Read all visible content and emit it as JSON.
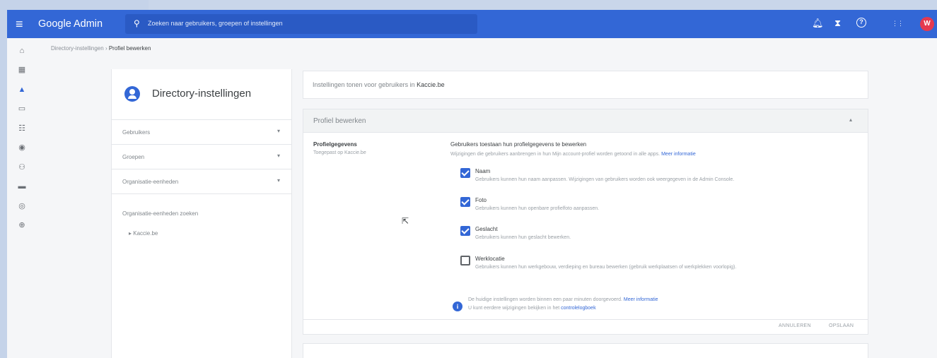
{
  "topbar": {
    "menu_icon": "≡",
    "brand": "Google Admin",
    "search_icon": "⚲",
    "search_placeholder": "Zoeken naar gebruikers, groepen of instellingen",
    "icons": [
      {
        "name": "notifications-icon",
        "glyph": "🔔︎"
      },
      {
        "name": "hourglass-icon",
        "glyph": "⧗"
      },
      {
        "name": "help-icon",
        "glyph": "?"
      },
      {
        "name": "apps-icon",
        "glyph": "⋮⋮"
      }
    ],
    "avatar_letter": "W",
    "colors": {
      "bar": "#3367d6",
      "avatar": "#e53950"
    }
  },
  "rail": {
    "icons": [
      {
        "name": "home-icon",
        "glyph": "⌂"
      },
      {
        "name": "dashboard-icon",
        "glyph": "▦"
      },
      {
        "name": "users-icon",
        "glyph": "▲",
        "active": true
      },
      {
        "name": "devices-icon",
        "glyph": "▭"
      },
      {
        "name": "apps-list-icon",
        "glyph": "☷"
      },
      {
        "name": "security-icon",
        "glyph": "◉"
      },
      {
        "name": "groups-icon",
        "glyph": "⚇"
      },
      {
        "name": "billing-icon",
        "glyph": "▬"
      },
      {
        "name": "account-icon",
        "glyph": "◎"
      },
      {
        "name": "rules-icon",
        "glyph": "⊕"
      }
    ]
  },
  "breadcrumb": {
    "parent": "Directory-instellingen",
    "separator": "›",
    "current": "Profiel bewerken"
  },
  "left_panel": {
    "title": "Directory-instellingen",
    "rows": [
      {
        "label": "Gebruikers",
        "chevron": "▾"
      },
      {
        "label": "Groepen",
        "chevron": "▾"
      },
      {
        "label": "Organisatie-eenheden",
        "chevron": "▾"
      }
    ],
    "subheading": "Organisatie-eenheden zoeken",
    "tree_item": "▸  Kaccie.be"
  },
  "main": {
    "intro_prefix": "Instellingen tonen voor gebruikers in",
    "intro_org": "Kaccie.be",
    "card_title": "Profiel bewerken",
    "collapse_icon": "▴",
    "section_label": "Profielgegevens",
    "section_sub": "Toegepast op Kaccie.be",
    "heading": "Gebruikers toestaan hun profielgegevens te bewerken",
    "description": "Wijzigingen die gebruikers aanbrengen in hun Mijn account-profiel worden getoond in alle apps.",
    "description_link": "Meer informatie",
    "options": [
      {
        "label": "Naam",
        "desc": "Gebruikers kunnen hun naam aanpassen. Wijzigingen van gebruikers worden ook weergegeven in de Admin Console.",
        "checked": true
      },
      {
        "label": "Foto",
        "desc": "Gebruikers kunnen hun openbare profielfoto aanpassen.",
        "checked": true
      },
      {
        "label": "Geslacht",
        "desc": "Gebruikers kunnen hun geslacht bewerken.",
        "checked": true
      },
      {
        "label": "Werklocatie",
        "desc": "Gebruikers kunnen hun werkgebouw, verdieping en bureau bewerken (gebruik werkplaatsen of werkplekken voorlopig).",
        "checked": false
      }
    ],
    "info_icon": "i",
    "info_line1": "De huidige instellingen worden binnen een paar minuten doorgevoerd.",
    "info_line1_link": "Meer informatie",
    "info_line2": "U kunt eerdere wijzigingen bekijken in het",
    "info_line2_link": "controlelogboek",
    "cancel_label": "ANNULEREN",
    "save_label": "OPSLAAN"
  }
}
